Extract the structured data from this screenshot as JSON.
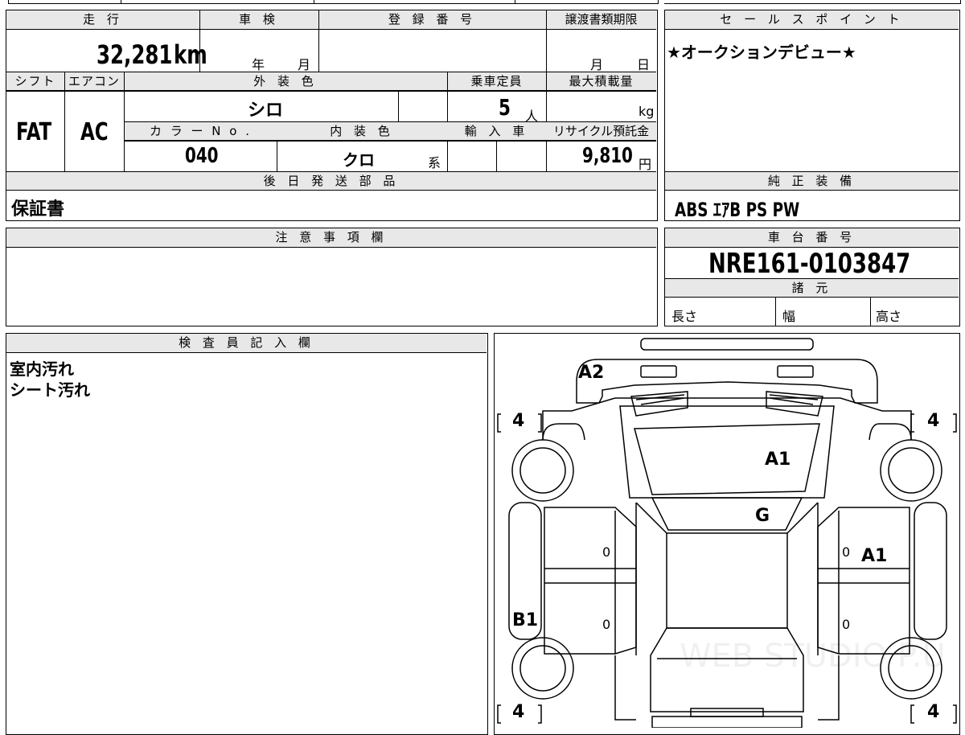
{
  "top": {
    "mileage_header": "走 行",
    "mileage_value": "32,281",
    "mileage_unit": "km",
    "inspection_header": "車 検",
    "inspection_year": "年",
    "inspection_month": "月",
    "registration_header": "登 録 番 号",
    "transfer_header": "譲渡書類期限",
    "transfer_month": "月",
    "transfer_day": "日"
  },
  "row2": {
    "shift_header": "シフト",
    "shift_value": "FAT",
    "ac_header": "エアコン",
    "ac_value": "AC",
    "exterior_header": "外 装 色",
    "exterior_value": "シロ",
    "capacity_header": "乗車定員",
    "capacity_value": "5",
    "capacity_unit": "人",
    "maxload_header": "最大積載量",
    "maxload_unit": "kg",
    "color_no_header": "カ ラ ー N o .",
    "color_no_value": "040",
    "interior_header": "内 装 色",
    "interior_value": "クロ",
    "interior_suffix": "系",
    "import_header": "輸 入 車",
    "recycle_header": "リサイクル預託金",
    "recycle_value": "9,810",
    "recycle_unit": "円"
  },
  "later_parts": {
    "header": "後 日 発 送 部 品",
    "value": "保証書"
  },
  "notes": {
    "header": "注 意 事 項 欄"
  },
  "sales": {
    "header": "セ ー ル ス ポ イ ン ト",
    "text": "★オークションデビュー★"
  },
  "equipment": {
    "header": "純 正 装 備",
    "value": "ABS ｴｱB PS PW"
  },
  "chassis": {
    "header": "車 台 番 号",
    "value": "NRE161-0103847"
  },
  "specs": {
    "header": "諸 元",
    "length": "長さ",
    "width": "幅",
    "height": "高さ"
  },
  "inspector": {
    "header": "検 査 員 記 入 欄",
    "line1": "室内汚れ",
    "line2": "シート汚れ"
  },
  "diagram": {
    "marks": {
      "a2": "A2",
      "a1_roof": "A1",
      "g_windshield": "G",
      "a1_right": "A1",
      "b1_left": "B1"
    },
    "tires": {
      "front_left": "4",
      "front_right": "4",
      "rear_left": "4",
      "rear_right": "4"
    },
    "zeros": {
      "z1": "0",
      "z2": "0",
      "z3": "0",
      "z4": "0"
    },
    "watermark": "WEB STUDIO P.U"
  }
}
